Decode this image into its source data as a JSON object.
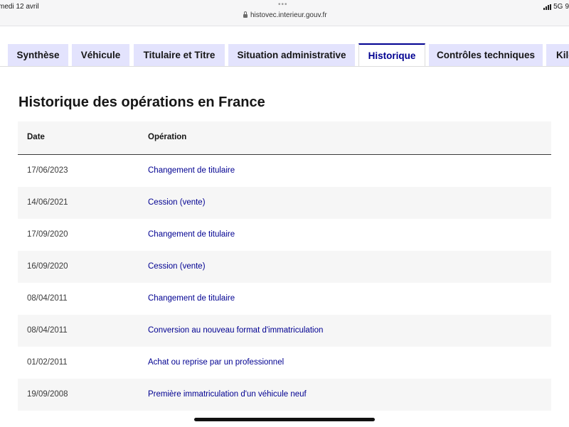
{
  "status_bar": {
    "date": "medi 12 avril",
    "dots": "•••",
    "url": "histovec.interieur.gouv.fr",
    "network": "5G",
    "battery": "9"
  },
  "tabs": [
    {
      "label": "Synthèse",
      "active": false
    },
    {
      "label": "Véhicule",
      "active": false
    },
    {
      "label": "Titulaire et Titre",
      "active": false
    },
    {
      "label": "Situation administrative",
      "active": false
    },
    {
      "label": "Historique",
      "active": true
    },
    {
      "label": "Contrôles techniques",
      "active": false
    },
    {
      "label": "Kilo",
      "active": false
    }
  ],
  "section_title": "Historique des opérations en France",
  "table": {
    "headers": {
      "date": "Date",
      "operation": "Opération"
    },
    "rows": [
      {
        "date": "17/06/2023",
        "operation": "Changement de titulaire"
      },
      {
        "date": "14/06/2021",
        "operation": "Cession (vente)"
      },
      {
        "date": "17/09/2020",
        "operation": "Changement de titulaire"
      },
      {
        "date": "16/09/2020",
        "operation": "Cession (vente)"
      },
      {
        "date": "08/04/2011",
        "operation": "Changement de titulaire"
      },
      {
        "date": "08/04/2011",
        "operation": "Conversion au nouveau format d'immatriculation"
      },
      {
        "date": "01/02/2011",
        "operation": "Achat ou reprise par un professionnel"
      },
      {
        "date": "19/09/2008",
        "operation": "Première immatriculation d'un véhicule neuf"
      }
    ]
  },
  "colors": {
    "accent": "#000091",
    "tab_bg": "#e3e3fd",
    "stripe": "#f6f6f6"
  }
}
